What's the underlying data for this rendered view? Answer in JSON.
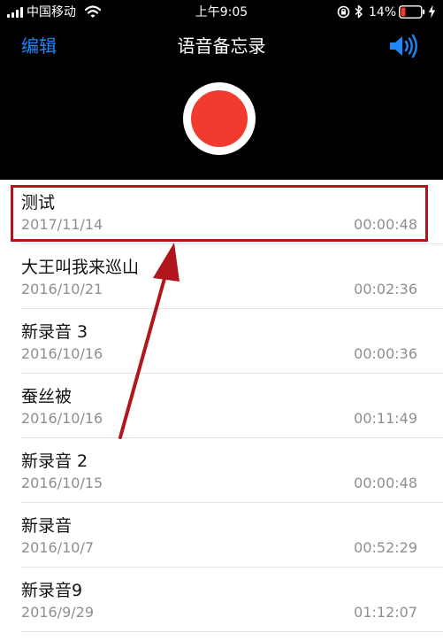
{
  "status_bar": {
    "carrier": "中国移动",
    "time": "上午9:05",
    "battery": "14%"
  },
  "nav": {
    "edit_label": "编辑",
    "title": "语音备忘录"
  },
  "icons": {
    "signal": "signal-bars-icon",
    "wifi": "wifi-icon",
    "lock": "rotation-lock-icon",
    "bluetooth": "bluetooth-icon",
    "battery": "battery-low-icon",
    "charging": "charging-bolt-icon",
    "speaker": "speaker-icon",
    "record": "record-icon"
  },
  "colors": {
    "accent": "#1e86f5",
    "record": "#f23b2e",
    "annotation": "#b0161c",
    "battery_low": "#f23b2e"
  },
  "memos": [
    {
      "name": "测试",
      "date": "2017/11/14",
      "duration": "00:00:48"
    },
    {
      "name": "大王叫我来巡山",
      "date": "2016/10/21",
      "duration": "00:02:36"
    },
    {
      "name": "新录音 3",
      "date": "2016/10/16",
      "duration": "00:00:36"
    },
    {
      "name": "蚕丝被",
      "date": "2016/10/16",
      "duration": "00:11:49"
    },
    {
      "name": "新录音 2",
      "date": "2016/10/15",
      "duration": "00:00:48"
    },
    {
      "name": "新录音",
      "date": "2016/10/7",
      "duration": "00:52:29"
    },
    {
      "name": "新录音9",
      "date": "2016/9/29",
      "duration": "01:12:07"
    }
  ]
}
